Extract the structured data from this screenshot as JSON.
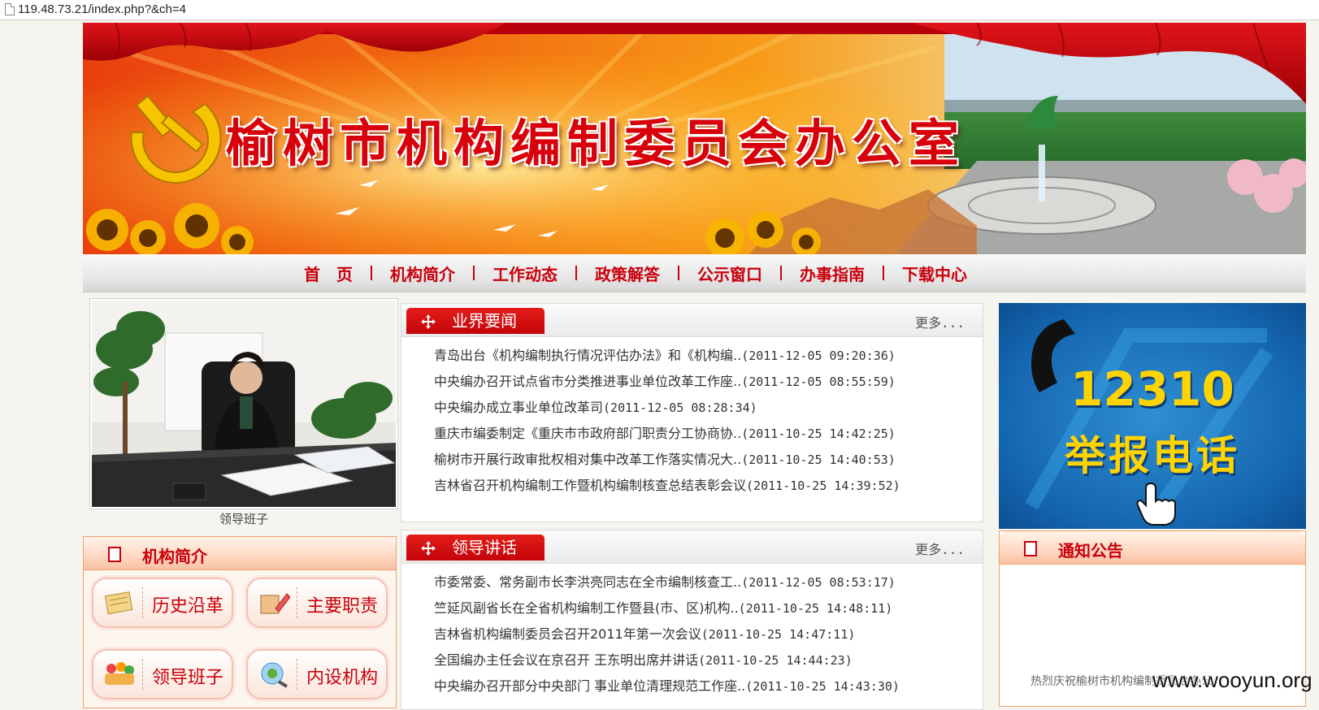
{
  "browser": {
    "url": "119.48.73.21/index.php?&ch=4"
  },
  "banner": {
    "title": "榆树市机构编制委员会办公室"
  },
  "nav": {
    "items": [
      "首　页",
      "机构简介",
      "工作动态",
      "政策解答",
      "公示窗口",
      "办事指南",
      "下载中心"
    ]
  },
  "leader": {
    "caption": "领导班子"
  },
  "intro_panel": {
    "title": "机构简介",
    "tiles": [
      {
        "label": "历史沿革",
        "icon": "history-icon"
      },
      {
        "label": "主要职责",
        "icon": "duties-icon"
      },
      {
        "label": "领导班子",
        "icon": "leaders-icon"
      },
      {
        "label": "内设机构",
        "icon": "departments-icon"
      }
    ]
  },
  "industry_news": {
    "title": "业界要闻",
    "more": "更多...",
    "items": [
      {
        "text": "青岛出台《机构编制执行情况评估办法》和《机构编..",
        "date": "(2011-12-05 09:20:36)"
      },
      {
        "text": "中央编办召开试点省市分类推进事业单位改革工作座..",
        "date": "(2011-12-05 08:55:59)"
      },
      {
        "text": "中央编办成立事业单位改革司",
        "date": "(2011-12-05 08:28:34)"
      },
      {
        "text": "重庆市编委制定《重庆市市政府部门职责分工协商协..",
        "date": "(2011-10-25 14:42:25)"
      },
      {
        "text": "榆树市开展行政审批权相对集中改革工作落实情况大..",
        "date": "(2011-10-25 14:40:53)"
      },
      {
        "text": "吉林省召开机构编制工作暨机构编制核查总结表彰会议",
        "date": "(2011-10-25 14:39:52)"
      }
    ]
  },
  "leader_speeches": {
    "title": "领导讲话",
    "more": "更多...",
    "items": [
      {
        "text": "市委常委、常务副市长李洪亮同志在全市编制核查工..",
        "date": "(2011-12-05 08:53:17)"
      },
      {
        "text": "竺延风副省长在全省机构编制工作暨县(市、区)机构..",
        "date": "(2011-10-25 14:48:11)"
      },
      {
        "text": "吉林省机构编制委员会召开2011年第一次会议",
        "date": "(2011-10-25 14:47:11)"
      },
      {
        "text": "全国编办主任会议在京召开 王东明出席并讲话",
        "date": "(2011-10-25 14:44:23)"
      },
      {
        "text": "中央编办召开部分中央部门 事业单位清理规范工作座..",
        "date": "(2011-10-25 14:43:30)"
      }
    ]
  },
  "report": {
    "number": "12310",
    "label": "举报电话"
  },
  "notice": {
    "title": "通知公告",
    "scroll_text": "热烈庆祝榆树市机构编制委员会办公"
  },
  "watermark": "www.wooyun.org",
  "colors": {
    "accent_red": "#c8000b",
    "tab_red": "#d9100f",
    "panel_border": "#f0a06a",
    "report_blue": "#1566b0",
    "report_yellow": "#ffd400"
  }
}
